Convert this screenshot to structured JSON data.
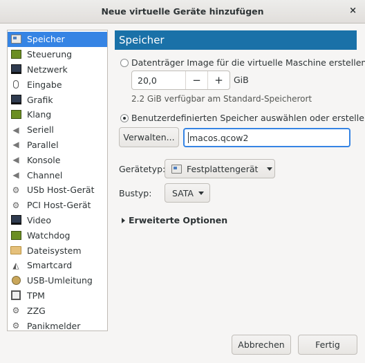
{
  "window": {
    "title": "Neue virtuelle Geräte hinzufügen",
    "close_glyph": "×"
  },
  "sidebar": {
    "items": [
      {
        "label": "Speicher",
        "icon": "storage-icon",
        "selected": true
      },
      {
        "label": "Steuerung",
        "icon": "controller-icon"
      },
      {
        "label": "Netzwerk",
        "icon": "network-icon"
      },
      {
        "label": "Eingabe",
        "icon": "mouse-icon"
      },
      {
        "label": "Grafik",
        "icon": "display-icon"
      },
      {
        "label": "Klang",
        "icon": "sound-icon"
      },
      {
        "label": "Seriell",
        "icon": "serial-icon"
      },
      {
        "label": "Parallel",
        "icon": "parallel-icon"
      },
      {
        "label": "Konsole",
        "icon": "console-icon"
      },
      {
        "label": "Channel",
        "icon": "channel-icon"
      },
      {
        "label": "USb Host-Gerät",
        "icon": "usb-host-icon"
      },
      {
        "label": "PCI Host-Gerät",
        "icon": "pci-host-icon"
      },
      {
        "label": "Video",
        "icon": "video-icon"
      },
      {
        "label": "Watchdog",
        "icon": "watchdog-icon"
      },
      {
        "label": "Dateisystem",
        "icon": "folder-icon"
      },
      {
        "label": "Smartcard",
        "icon": "smartcard-icon"
      },
      {
        "label": "USB-Umleitung",
        "icon": "usb-redirect-icon"
      },
      {
        "label": "TPM",
        "icon": "tpm-icon"
      },
      {
        "label": "ZZG",
        "icon": "rng-icon"
      },
      {
        "label": "Panikmelder",
        "icon": "panic-icon"
      }
    ]
  },
  "main": {
    "header": "Speicher",
    "option_create": "Datenträger Image für die virtuelle Maschine erstellen",
    "size_value": "20,0",
    "size_minus": "−",
    "size_plus": "+",
    "size_unit": "GiB",
    "available_text": "2.2 GiB verfügbar am Standard-Speicherort",
    "option_custom": "Benutzerdefinierten Speicher auswählen oder erstellen",
    "manage_label": "Verwalten...",
    "path_value": "macos.qcow2",
    "device_type_label": "Gerätetyp:",
    "device_type_value": "Festplattengerät",
    "bus_type_label": "Bustyp:",
    "bus_type_value": "SATA",
    "advanced_label": "Erweiterte Optionen"
  },
  "footer": {
    "cancel_label": "Abbrechen",
    "finish_label": "Fertig"
  },
  "colors": {
    "accent": "#3584e4",
    "header": "#1a71a8"
  }
}
